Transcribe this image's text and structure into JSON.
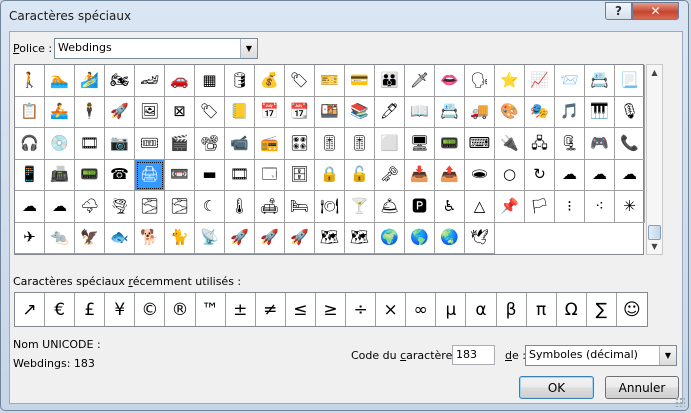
{
  "window": {
    "title": "Caractères spéciaux",
    "help_glyph": "?",
    "close_glyph": "✕"
  },
  "font_row": {
    "label_prefix": "P",
    "label_rest": "olice :",
    "value": "Webdings"
  },
  "symbol_grid": {
    "selected_index": 67,
    "cells": [
      "🚶",
      "🏊",
      "🏄",
      "🏍",
      "🏎",
      "🚗",
      "▦",
      "🛢",
      "💰",
      "🏷",
      "🎫",
      "💳",
      "👪",
      "🗡",
      "👄",
      "🗣",
      "⭐",
      "📈",
      "📨",
      "📇",
      "📃",
      "📋",
      "🚣",
      "🕴",
      "🚀",
      "🖼",
      "⊠",
      "🏷",
      "📒",
      "📅",
      "📆",
      "🍱",
      "📚",
      "🖊",
      "📖",
      "📇",
      "🚚",
      "🎨",
      "🎭",
      "🎵",
      "🎹",
      "🎙",
      "🎧",
      "💿",
      "🎞",
      "📷",
      "🎟",
      "🎬",
      "📽",
      "📹",
      "📻",
      "🎛",
      "🎚",
      "🎚",
      "⬜",
      "🖥",
      "📟",
      "⌨",
      "🔌",
      "🖧",
      "🗜",
      "🎮",
      "📞",
      "📱",
      "📠",
      "📟",
      "☎",
      "🖨",
      "📼",
      "▬",
      "🎞",
      "🗔",
      "🗄",
      "🔒",
      "🔓",
      "🗝",
      "📥",
      "📤",
      "🕳",
      "○",
      "↻",
      "☁",
      "☁",
      "☁",
      "☁",
      "☁",
      "🌩",
      "🌪",
      "🌫",
      "🌫",
      "☾",
      "🌡",
      "🛋",
      "🛏",
      "🍽",
      "🍸",
      "🛎",
      "🅿",
      "♿",
      "△",
      "📌",
      "🏳",
      "⁝",
      "⁖",
      "✳",
      "✈",
      "🐀",
      "🦅",
      "🐟",
      "🐕",
      "🐈",
      "📡",
      "🚀",
      "🚀",
      "🚀",
      "🗺",
      "🗺",
      "🌍",
      "🌎",
      "🌏",
      "🕊",
      "",
      "",
      "",
      "",
      "",
      "",
      ""
    ]
  },
  "recent": {
    "label_before": "Caractères spéciaux ",
    "label_underlined": "r",
    "label_after": "écemment utilisés :",
    "symbols": [
      "↗",
      "€",
      "£",
      "¥",
      "©",
      "®",
      "™",
      "±",
      "≠",
      "≤",
      "≥",
      "÷",
      "×",
      "∞",
      "µ",
      "α",
      "β",
      "π",
      "Ω",
      "∑",
      "☺"
    ]
  },
  "unicode": {
    "label": "Nom UNICODE :",
    "value": "Webdings: 183"
  },
  "char_code": {
    "label_before": "Code du ",
    "label_underlined": "c",
    "label_after": "aractère :",
    "value": "183"
  },
  "from": {
    "label_underlined": "d",
    "label_after": "e :",
    "value": "Symboles (décimal)"
  },
  "buttons": {
    "ok": "OK",
    "cancel": "Annuler"
  }
}
